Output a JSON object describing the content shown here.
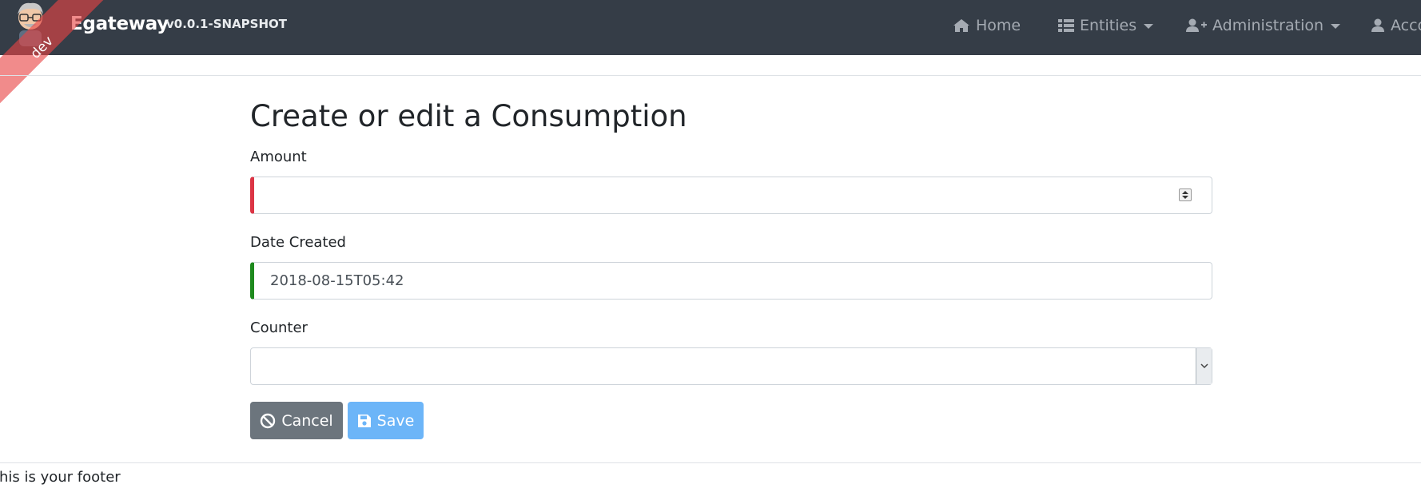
{
  "navbar": {
    "brand_initial": "E",
    "brand_rest": "gateway",
    "version": "v0.0.1-SNAPSHOT",
    "items": [
      {
        "label": "Home",
        "icon": "home-icon"
      },
      {
        "label": "Entities",
        "icon": "list-icon"
      },
      {
        "label": "Administration",
        "icon": "user-plus-icon"
      },
      {
        "label": "Account",
        "icon": "user-icon"
      }
    ]
  },
  "ribbon": {
    "label": "dev"
  },
  "form": {
    "title": "Create or edit a Consumption",
    "fields": [
      {
        "label": "Amount",
        "value": ""
      },
      {
        "label": "Date Created",
        "value": "2018-08-15T05:42"
      },
      {
        "label": "Counter",
        "value": ""
      }
    ],
    "cancel_label": "Cancel",
    "save_label": "Save"
  },
  "footer": {
    "text": "This is your footer"
  },
  "colors": {
    "navbar_bg": "#353d47",
    "invalid": "#dc3545",
    "valid": "#1e8a1e",
    "cancel": "#6c757d",
    "save": "#6cb5f8"
  }
}
